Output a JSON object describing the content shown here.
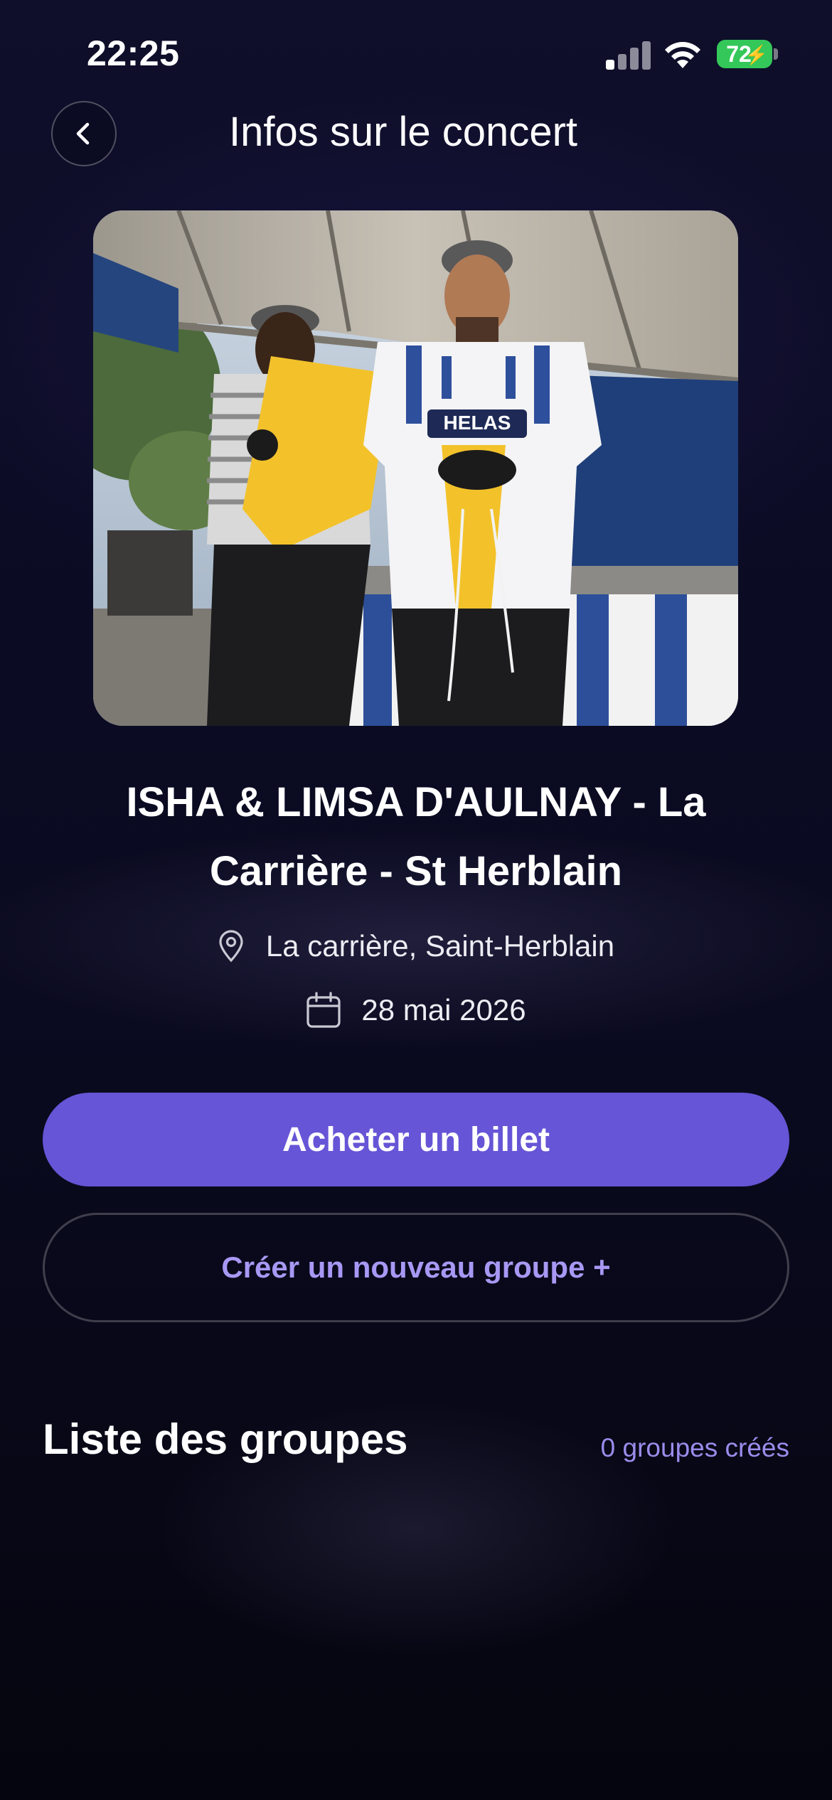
{
  "status_bar": {
    "time": "22:25",
    "battery_level": "72"
  },
  "header": {
    "title": "Infos sur le concert",
    "back_icon": "chevron-left-icon"
  },
  "concert": {
    "title": "ISHA & LIMSA D'AULNAY - La Carrière - St Herblain",
    "location": "La carrière, Saint-Herblain",
    "date": "28 mai 2026",
    "location_icon": "map-pin-icon",
    "date_icon": "calendar-icon"
  },
  "actions": {
    "buy_label": "Acheter un billet",
    "create_group_label": "Créer un nouveau groupe +"
  },
  "groups": {
    "heading": "Liste des groupes",
    "count_label": "0 groupes créés"
  },
  "colors": {
    "accent": "#6655d6",
    "accent_text": "#a898f4",
    "background": "#0b0b24",
    "battery": "#34c759"
  }
}
